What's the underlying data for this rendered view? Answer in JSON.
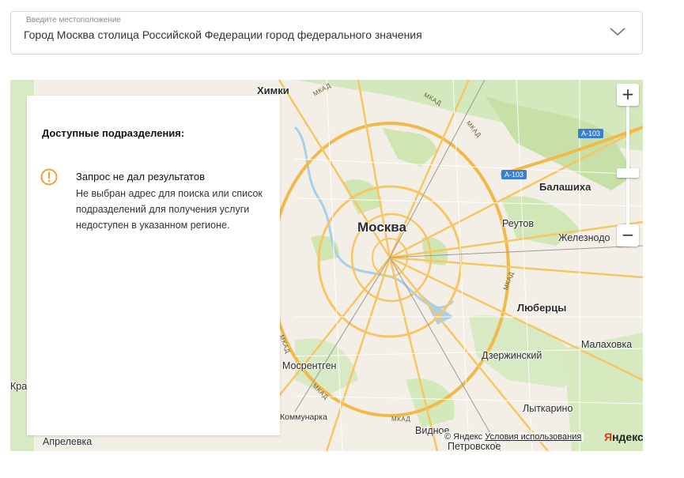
{
  "location": {
    "label": "Введите местоположение",
    "value": "Город Москва столица Российской Федерации город федерального значения",
    "dropdown_icon": "chevron-down-icon"
  },
  "map": {
    "labels": {
      "khimki": "Химки",
      "moskva": "Москва",
      "balashikha": "Балашиха",
      "reutov": "Реутов",
      "zheleznodor": "Железнодо",
      "lyubertsy": "Люберцы",
      "dzerzhinsky": "Дзержинский",
      "malakhovka": "Малаховка",
      "mosrentgen": "Мосрентген",
      "lytkarino": "Лыткарино",
      "kommunarka": "Коммунарка",
      "vidnoe": "Видное",
      "aprelevka": "Апрелевка",
      "petrovskoe": "Петровское",
      "kra": "Кра"
    },
    "road_signs": [
      "А-103",
      "А-103"
    ],
    "mkad_label": "МКАД",
    "zoom_in": "+",
    "zoom_out": "−",
    "copyright_prefix": "© Яндекс",
    "copyright_link": "Условия использования",
    "logo_first": "Я",
    "logo_rest": "ндекс"
  },
  "panel": {
    "title": "Доступные подразделения:",
    "result_title": "Запрос не дал результатов",
    "result_text": "Не выбран адрес для поиска или список подразделений для получения услуги недоступен в указанном регионе.",
    "icon": "warning-circle-icon"
  },
  "colors": {
    "warning": "#f0a030",
    "road_sign": "#3a7fcf",
    "map_bg": "#f3efe6",
    "park": "#cfe6b3",
    "road": "#f7c664",
    "water": "#a9cfe8"
  }
}
